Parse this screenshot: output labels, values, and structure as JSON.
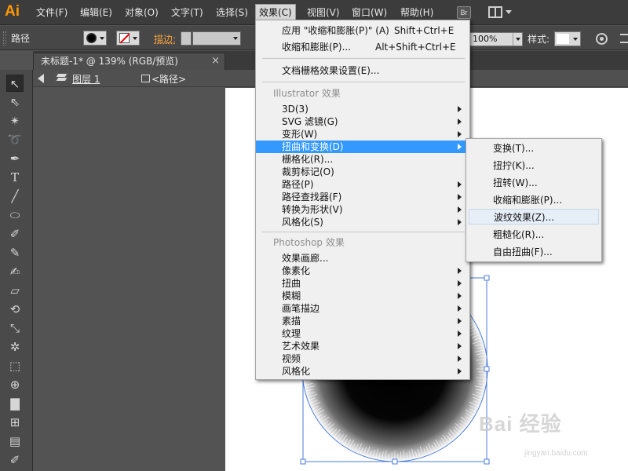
{
  "app": {
    "logo": "Ai"
  },
  "menubar": {
    "items": [
      "文件(F)",
      "编辑(E)",
      "对象(O)",
      "文字(T)",
      "选择(S)",
      "效果(C)",
      "视图(V)",
      "窗口(W)",
      "帮助(H)"
    ],
    "active": "效果(C)",
    "bridge_label": "Br"
  },
  "control_bar": {
    "label": "路径",
    "stroke_label": "描边:",
    "opacity": "100%",
    "style_label": "样式:"
  },
  "document": {
    "tab_title": "未标题-1* @ 139% (RGB/预览)",
    "tab_close": "×"
  },
  "breadcrumb": {
    "layer": "图层 1",
    "object": "<路径>"
  },
  "toolbox": {
    "tools": [
      "selection-tool",
      "direct-selection-tool",
      "magic-wand-tool",
      "lasso-tool",
      "pen-tool",
      "type-tool",
      "line-segment-tool",
      "ellipse-tool",
      "paintbrush-tool",
      "pencil-tool",
      "blob-brush-tool",
      "eraser-tool",
      "rotate-tool",
      "scale-tool",
      "warp-tool",
      "free-transform-tool",
      "shape-builder-tool",
      "column-graph-tool",
      "mesh-tool",
      "gradient-tool",
      "eyedropper-tool"
    ]
  },
  "effect_menu": {
    "apply_last": {
      "label": "应用 \"收缩和膨胀(P)\" (A)",
      "shortcut": "Shift+Ctrl+E"
    },
    "last_effect": {
      "label": "收缩和膨胀(P)...",
      "shortcut": "Alt+Shift+Ctrl+E"
    },
    "raster_settings": "文档栅格效果设置(E)...",
    "illustrator_header": "Illustrator 效果",
    "illustrator_items": [
      "3D(3)",
      "SVG 滤镜(G)",
      "变形(W)",
      "扭曲和变换(D)",
      "栅格化(R)...",
      "裁剪标记(O)",
      "路径(P)",
      "路径查找器(F)",
      "转换为形状(V)",
      "风格化(S)"
    ],
    "highlighted": "扭曲和变换(D)",
    "photoshop_header": "Photoshop 效果",
    "photoshop_items": [
      "效果画廊...",
      "像素化",
      "扭曲",
      "模糊",
      "画笔描边",
      "素描",
      "纹理",
      "艺术效果",
      "视频",
      "风格化"
    ]
  },
  "distort_submenu": {
    "items": [
      "变换(T)...",
      "扭拧(K)...",
      "扭转(W)...",
      "收缩和膨胀(P)...",
      "波纹效果(Z)...",
      "粗糙化(R)...",
      "自由扭曲(F)..."
    ],
    "hovered": "波纹效果(Z)..."
  },
  "watermark": {
    "brand": "Bai 经验",
    "url": "jingyan.baidu.com"
  },
  "colors": {
    "menu_highlight": "#3399ff",
    "logo": "#ff9a00",
    "stroke_label": "#f0a040",
    "selection": "#4a7bd8"
  }
}
